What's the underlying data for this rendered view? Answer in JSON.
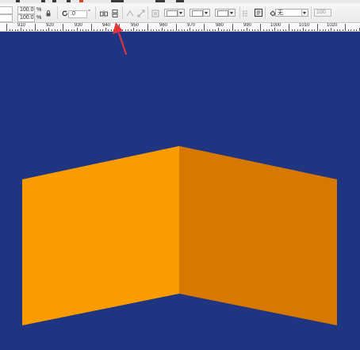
{
  "toolbar": {
    "scale_x": "100.0",
    "scale_y": "100.0",
    "percent_x": "%",
    "percent_y": "%",
    "rotation": ".0",
    "degree": "°",
    "fill_none_label": "无",
    "opacity": "100"
  },
  "ruler": {
    "labels": [
      "910",
      "920",
      "930",
      "940",
      "950",
      "960",
      "970",
      "980",
      "990",
      "1000",
      "1010",
      "1020"
    ]
  },
  "canvas": {
    "background": "#1f3582",
    "left_panel_color": "#f99c00",
    "right_panel_color": "#d77800"
  },
  "annotation": {
    "arrow_color": "#e8343c"
  }
}
